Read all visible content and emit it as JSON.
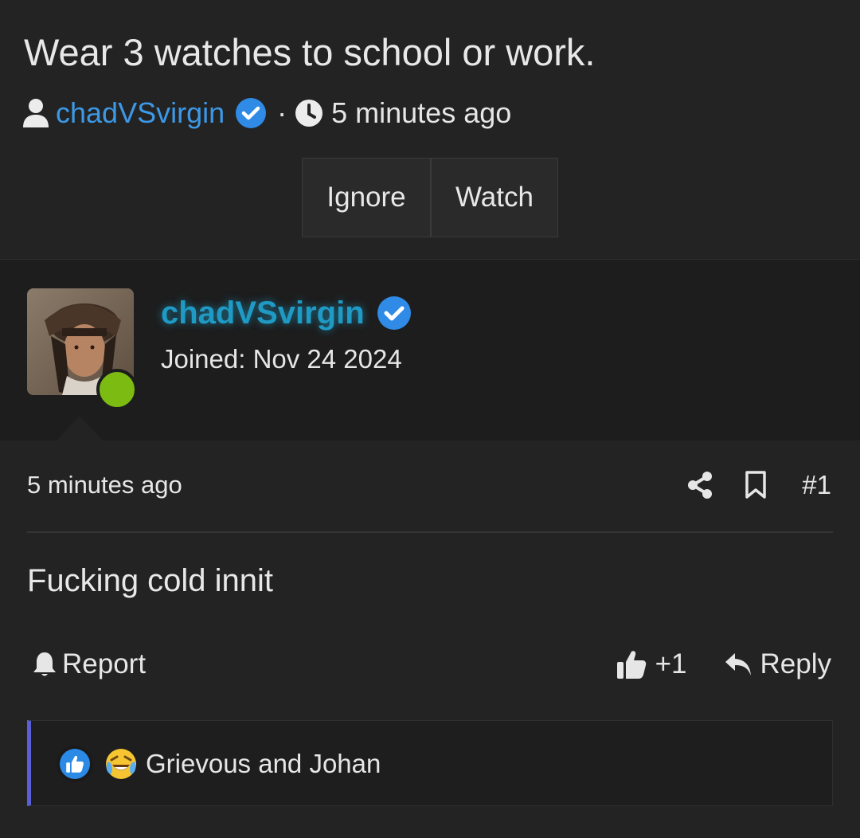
{
  "thread": {
    "title": "Wear 3 watches to school or work.",
    "author": "chadVSvirgin",
    "separator": "·",
    "time": "5 minutes ago",
    "buttons": {
      "ignore": "Ignore",
      "watch": "Watch"
    }
  },
  "post": {
    "username": "chadVSvirgin",
    "joined": "Joined: Nov 24 2024",
    "time": "5 minutes ago",
    "number": "#1",
    "message": "Fucking cold innit",
    "report_label": "Report",
    "like_count": "+1",
    "reply_label": "Reply",
    "reactions_text": "Grievous and Johan",
    "status": "online"
  },
  "icons": [
    "user-icon",
    "verified-badge-icon",
    "clock-icon",
    "share-icon",
    "bookmark-icon",
    "bell-icon",
    "thumbs-up-icon",
    "reply-icon",
    "like-reaction-icon",
    "laugh-reaction-icon"
  ],
  "colors": {
    "background": "#232323",
    "user_panel": "#1d1d1d",
    "link_blue": "#3d98e6",
    "username_cyan": "#1f9ac4",
    "verified_blue": "#2f8be6",
    "online_green": "#7bbb12",
    "reaction_border": "#5a5fd6"
  }
}
